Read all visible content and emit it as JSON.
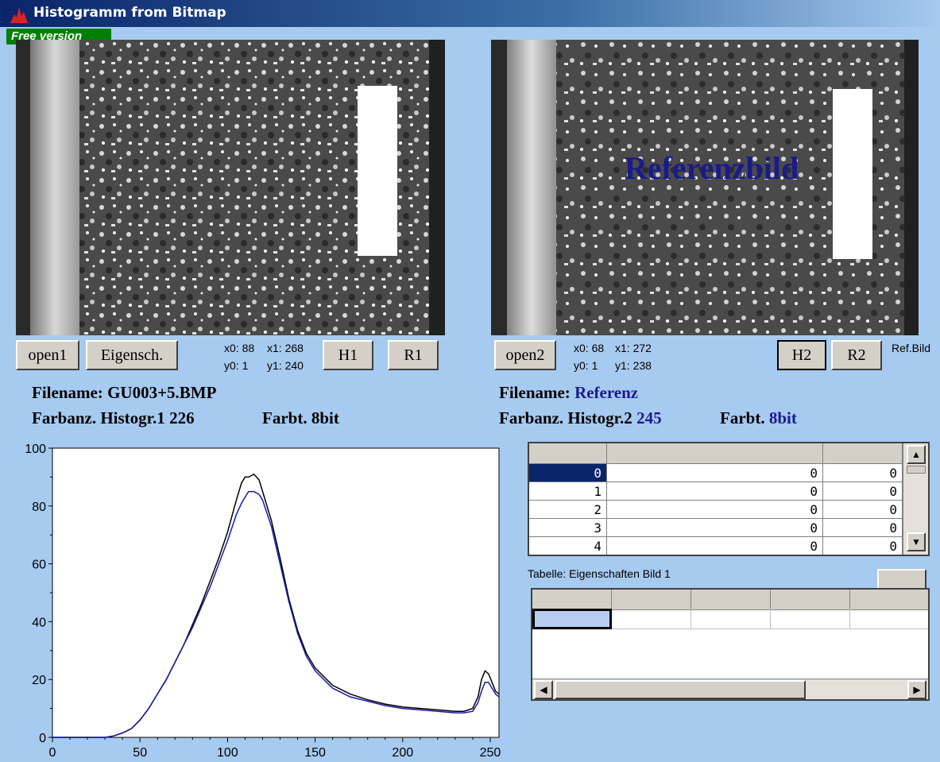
{
  "window": {
    "title": "Histogramm from Bitmap",
    "badge": "Free version"
  },
  "image1": {
    "open_label": "open1",
    "props_label": "Eigensch.",
    "x0": "x0: 88",
    "x1": "x1: 268",
    "y0": "y0: 1",
    "y1": "y1: 240",
    "h_label": "H1",
    "r_label": "R1",
    "filename_label": "Filename:",
    "filename": "GU003+5.BMP",
    "colors_label": "Farbanz. Histogr.1",
    "colors": "226",
    "depth_label": "Farbt.",
    "depth": "8bit"
  },
  "image2": {
    "open_label": "open2",
    "x0": "x0: 68",
    "x1": "x1: 272",
    "y0": "y0: 1",
    "y1": "y1: 238",
    "h_label": "H2",
    "r_label": "R2",
    "ref_label": "Ref.Bild",
    "overlay": "Referenzbild",
    "filename_label": "Filename:",
    "filename": "Referenz",
    "colors_label": "Farbanz. Histogr.2",
    "colors": "245",
    "depth_label": "Farbt.",
    "depth": "8bit"
  },
  "table1": {
    "rows": [
      [
        "0",
        "0",
        "0"
      ],
      [
        "1",
        "0",
        "0"
      ],
      [
        "2",
        "0",
        "0"
      ],
      [
        "3",
        "0",
        "0"
      ],
      [
        "4",
        "0",
        "0"
      ]
    ]
  },
  "table2": {
    "caption": "Tabelle: Eigenschaften Bild 1"
  },
  "colors": {
    "series1": "#000000",
    "series2": "#1a1aa8",
    "background": "#a6caf0"
  },
  "chart_data": {
    "type": "line",
    "x_ticks": [
      "0",
      "50",
      "100",
      "150",
      "200",
      "250"
    ],
    "y_ticks": [
      "0",
      "20",
      "40",
      "60",
      "80",
      "100"
    ],
    "xlim": [
      0,
      255
    ],
    "ylim": [
      0,
      100
    ],
    "series": [
      {
        "x": [
          0,
          30,
          35,
          40,
          45,
          50,
          55,
          60,
          65,
          70,
          75,
          80,
          85,
          90,
          95,
          100,
          105,
          108,
          110,
          112,
          115,
          118,
          120,
          125,
          130,
          135,
          140,
          145,
          150,
          160,
          170,
          180,
          190,
          200,
          210,
          220,
          230,
          235,
          240,
          243,
          245,
          247,
          249,
          251,
          253,
          255
        ],
        "values": [
          0,
          0,
          0.5,
          1.5,
          3,
          6,
          10,
          15,
          20,
          26,
          32,
          39,
          46,
          54,
          62,
          71,
          82,
          88,
          90,
          90,
          91,
          89,
          85,
          75,
          62,
          48,
          37,
          29,
          24,
          18,
          15,
          13,
          11.5,
          10.5,
          10,
          9.5,
          9,
          9,
          10,
          14,
          20,
          23,
          22,
          19,
          16,
          15
        ]
      },
      {
        "x": [
          0,
          30,
          35,
          40,
          45,
          50,
          55,
          60,
          65,
          70,
          75,
          80,
          85,
          90,
          95,
          100,
          105,
          108,
          110,
          112,
          115,
          118,
          120,
          125,
          130,
          135,
          140,
          145,
          150,
          160,
          170,
          180,
          190,
          200,
          210,
          220,
          230,
          235,
          240,
          243,
          245,
          247,
          249,
          251,
          253,
          255
        ],
        "values": [
          0,
          0,
          0.5,
          1.5,
          3,
          6,
          10,
          15,
          20,
          26,
          32,
          38,
          45,
          52,
          60,
          68,
          77,
          81,
          83,
          85,
          85,
          84,
          82,
          73,
          60,
          47,
          36,
          28,
          23,
          17,
          14,
          12.5,
          11,
          10,
          9.5,
          9,
          8.5,
          8.5,
          9,
          12,
          16,
          19,
          19,
          17,
          15,
          14
        ]
      }
    ]
  }
}
